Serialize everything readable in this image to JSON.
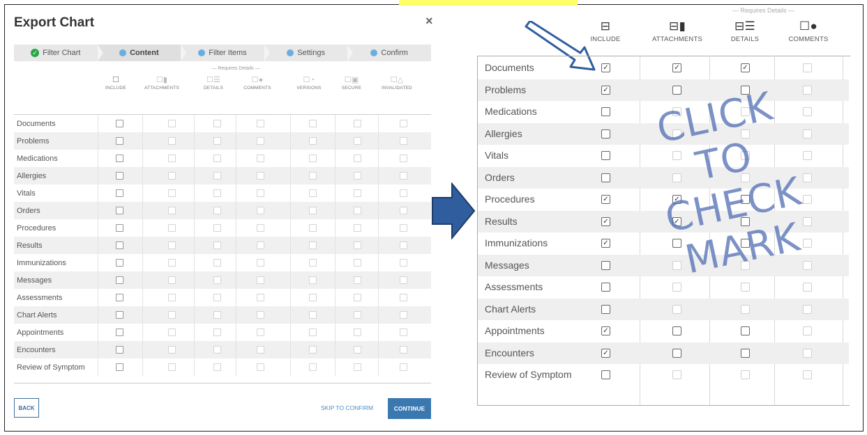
{
  "dialog": {
    "title": "Export Chart",
    "close": "×",
    "steps": [
      {
        "label": "Filter Chart",
        "state": "done",
        "mark": "✓"
      },
      {
        "label": "Content",
        "state": "active"
      },
      {
        "label": "Filter Items",
        "state": "todo"
      },
      {
        "label": "Settings",
        "state": "todo"
      },
      {
        "label": "Confirm",
        "state": "todo"
      }
    ],
    "requires_details": "— Requires Details —",
    "columns": [
      "INCLUDE",
      "ATTACHMENTS",
      "DETAILS",
      "COMMENTS",
      "VERSIONS",
      "SECURE",
      "INVALIDATED"
    ],
    "rows": [
      "Documents",
      "Problems",
      "Medications",
      "Allergies",
      "Vitals",
      "Orders",
      "Procedures",
      "Results",
      "Immunizations",
      "Messages",
      "Assessments",
      "Chart Alerts",
      "Appointments",
      "Encounters",
      "Review of Symptom"
    ],
    "back_label": "BACK",
    "skip_label": "SKIP TO CONFIRM",
    "continue_label": "CONTINUE"
  },
  "zoom": {
    "requires_details": "— Requires Details —",
    "columns": [
      "INCLUDE",
      "ATTACHMENTS",
      "DETAILS",
      "COMMENTS"
    ],
    "rows": [
      {
        "label": "Documents",
        "checks": [
          true,
          true,
          true,
          false
        ]
      },
      {
        "label": "Problems",
        "checks": [
          true,
          false,
          false,
          false
        ]
      },
      {
        "label": "Medications",
        "checks": [
          false,
          false,
          false,
          false
        ]
      },
      {
        "label": "Allergies",
        "checks": [
          false,
          false,
          false,
          false
        ]
      },
      {
        "label": "Vitals",
        "checks": [
          false,
          false,
          false,
          false
        ]
      },
      {
        "label": "Orders",
        "checks": [
          false,
          false,
          false,
          false
        ]
      },
      {
        "label": "Procedures",
        "checks": [
          true,
          true,
          false,
          false
        ]
      },
      {
        "label": "Results",
        "checks": [
          true,
          true,
          false,
          false
        ]
      },
      {
        "label": "Immunizations",
        "checks": [
          true,
          false,
          false,
          false
        ]
      },
      {
        "label": "Messages",
        "checks": [
          false,
          false,
          false,
          false
        ]
      },
      {
        "label": "Assessments",
        "checks": [
          false,
          false,
          false,
          false
        ]
      },
      {
        "label": "Chart Alerts",
        "checks": [
          false,
          false,
          false,
          false
        ]
      },
      {
        "label": "Appointments",
        "checks": [
          true,
          false,
          false,
          false
        ]
      },
      {
        "label": "Encounters",
        "checks": [
          true,
          false,
          false,
          false
        ]
      },
      {
        "label": "Review of Symptom",
        "checks": [
          false,
          false,
          false,
          false
        ]
      }
    ],
    "annotation": [
      "CLICK TO",
      "CHECK",
      "MARK"
    ]
  },
  "colors": {
    "accent_blue": "#3a78b0",
    "step_done_green": "#2aa64a",
    "arrow_blue": "#2f5d9e",
    "annotation": "#506eb4",
    "highlight_yellow": "#ffff66"
  }
}
